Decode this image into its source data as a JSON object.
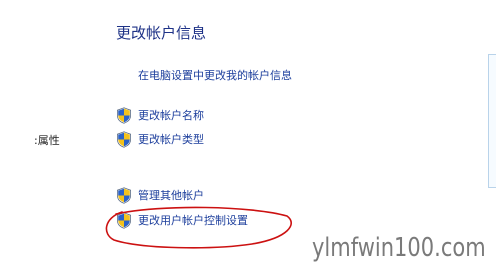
{
  "heading": "更改帐户信息",
  "links": {
    "change_my_info": "在电脑设置中更改我的帐户信息",
    "change_name": "更改帐户名称",
    "change_type": "更改帐户类型",
    "manage_other": "管理其他帐户",
    "change_uac": "更改用户帐户控制设置"
  },
  "left_panel": {
    "properties_label": ":属性"
  },
  "icons": {
    "task_icon": "uac-shield-icon"
  },
  "annotation": {
    "color": "#cc1111",
    "target": "更改用户帐户控制设置"
  },
  "watermark": "ylmfwin100.com",
  "colors": {
    "heading": "#1e3287",
    "link": "#1c3e9c",
    "shield_blue": "#2a62c9",
    "shield_yellow": "#f4c21c"
  }
}
